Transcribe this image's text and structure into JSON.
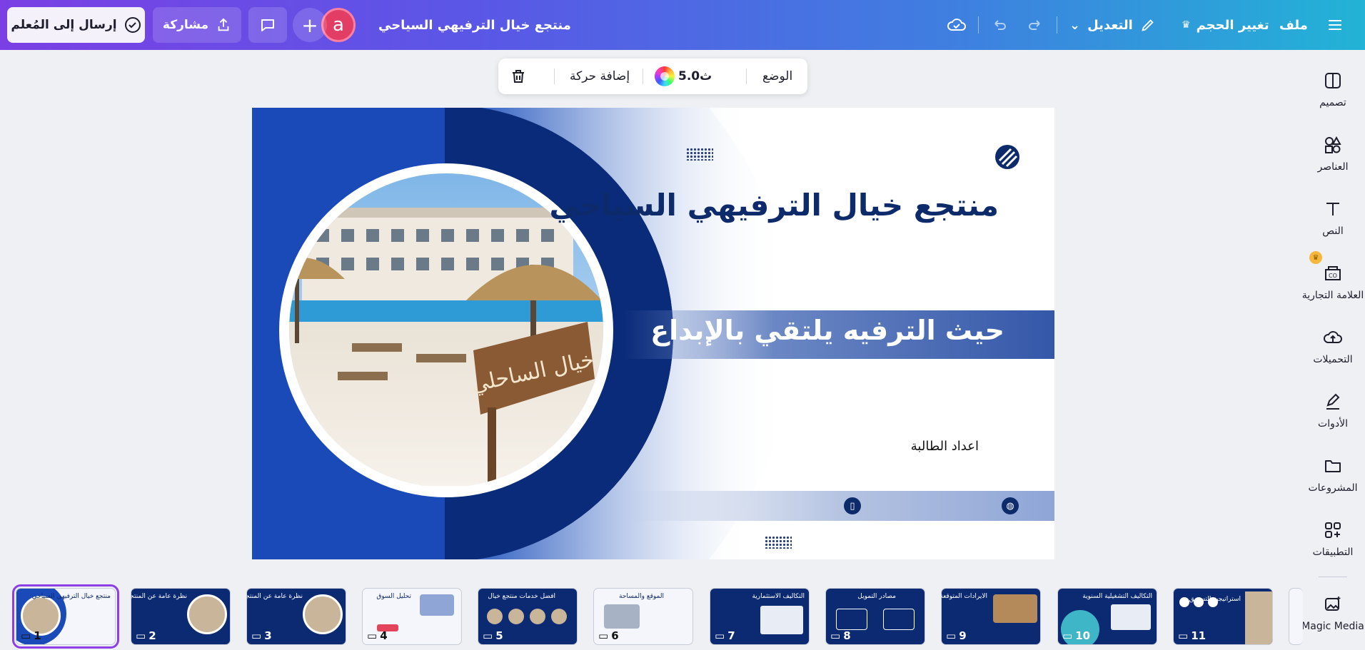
{
  "topbar": {
    "menu_icon": "hamburger-icon",
    "file_label": "ملف",
    "resize_label": "تغيير الحجم",
    "edit_label": "التعديل",
    "doc_title": "منتجع خيال الترفيهي السياحي",
    "share_label": "مشاركة",
    "send_label": "إرسال إلى المُعلم",
    "avatar_letter": "a",
    "plus": "+"
  },
  "floating_toolbar": {
    "position_label": "الوضع",
    "animate_label": "إضافة حركة",
    "duration_label": "5.0ث"
  },
  "slide": {
    "title": "منتجع خيال الترفيهي السياحي",
    "subtitle": "حيث الترفيه يلتقي بالإبداع",
    "prepared_by": "اعداد الطالبة",
    "sign_text": "خيال الساحلي"
  },
  "sidebar": {
    "items": [
      {
        "label": "تصميم",
        "icon": "design-icon"
      },
      {
        "label": "العناصر",
        "icon": "elements-icon"
      },
      {
        "label": "النص",
        "icon": "text-icon"
      },
      {
        "label": "العلامة التجارية",
        "icon": "brand-icon"
      },
      {
        "label": "التحميلات",
        "icon": "upload-cloud-icon"
      },
      {
        "label": "الأدوات",
        "icon": "draw-tools-icon"
      },
      {
        "label": "المشروعات",
        "icon": "folder-icon"
      },
      {
        "label": "التطبيقات",
        "icon": "apps-icon"
      },
      {
        "label": "Magic Media",
        "icon": "magic-media-icon"
      }
    ]
  },
  "filmstrip": {
    "thumbs": [
      {
        "num": "1",
        "title": "منتجع خيال الترفيهي السياحي"
      },
      {
        "num": "2",
        "title": "نظرة عامة عن المنتجع"
      },
      {
        "num": "3",
        "title": "نظرة عامة عن المنتجع"
      },
      {
        "num": "4",
        "title": "تحليل السوق"
      },
      {
        "num": "5",
        "title": "افضل خدمات منتجع خيال"
      },
      {
        "num": "6",
        "title": "الموقع والمساحة"
      },
      {
        "num": "7",
        "title": "التكاليف الاستثمارية"
      },
      {
        "num": "8",
        "title": "مصادر التمويل"
      },
      {
        "num": "9",
        "title": "الايرادات المتوقعة"
      },
      {
        "num": "10",
        "title": "التكاليف التشغيلية السنوية"
      },
      {
        "num": "11",
        "title": "استراتيجية التسويق"
      }
    ]
  },
  "colors": {
    "accent": "#8b3fe4",
    "navy": "#0d2a6b",
    "blue": "#1a4db3"
  }
}
